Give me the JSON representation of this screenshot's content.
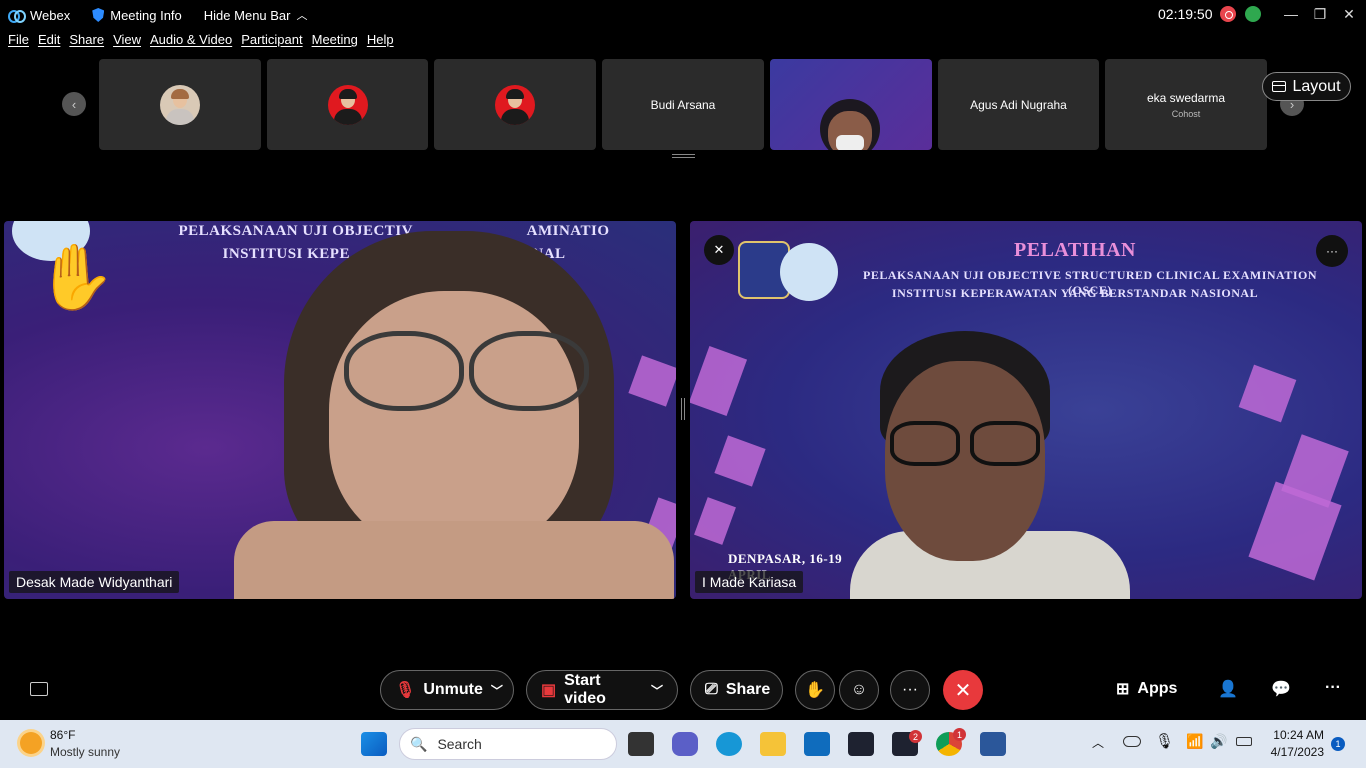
{
  "titlebar": {
    "app_name": "Webex",
    "meeting_info": "Meeting Info",
    "hide_menu": "Hide Menu Bar",
    "clock": "02:19:50",
    "minimize": "—",
    "restore": "❐",
    "close": "✕"
  },
  "menu": [
    "File",
    "Edit",
    "Share",
    "View",
    "Audio & Video",
    "Participant",
    "Meeting",
    "Help"
  ],
  "filmstrip": {
    "tiles": [
      {
        "name": "",
        "subtitle": ""
      },
      {
        "name": "",
        "subtitle": ""
      },
      {
        "name": "",
        "subtitle": ""
      },
      {
        "name": "Budi Arsana",
        "subtitle": ""
      },
      {
        "name": "",
        "subtitle": ""
      },
      {
        "name": "Agus Adi Nugraha",
        "subtitle": ""
      },
      {
        "name": "eka swedarma",
        "subtitle": "Cohost"
      }
    ],
    "prev_glyph": "‹",
    "next_glyph": "›"
  },
  "layout_label": "Layout",
  "stage": {
    "left": {
      "name": "Desak Made Widyanthari",
      "slide_line1": "PELAKSANAAN UJI OBJECTIV                           AMINATIO",
      "slide_line2": "INSTITUSI KEPE                                  ASIONAL",
      "hand_emoji": "✋"
    },
    "right": {
      "name": "I Made Kariasa",
      "slide_title": "PELATIHAN",
      "slide_line1": "PELAKSANAAN UJI OBJECTIVE STRUCTURED CLINICAL EXAMINATION (OSCE)",
      "slide_line2": "INSTITUSI KEPERAWATAN YANG BERSTANDAR NASIONAL",
      "slide_footer": "DENPASAR, 16-19 APRIL",
      "more_glyph": "···"
    }
  },
  "controls": {
    "unmute": "Unmute",
    "start_video": "Start video",
    "share": "Share",
    "more": "···",
    "end": "✕",
    "apps": "Apps",
    "overflow": "···"
  },
  "taskbar": {
    "temp": "86°F",
    "weather": "Mostly sunny",
    "search_placeholder": "Search",
    "time": "10:24 AM",
    "date": "4/17/2023",
    "webex_badge": "2",
    "chrome_badge": "1",
    "notif_badge": "1"
  },
  "colors": {
    "end_call": "#e8393c",
    "recording": "#e8454d",
    "stats": "#2fa84f",
    "taskbar": "#dfe7f2"
  }
}
